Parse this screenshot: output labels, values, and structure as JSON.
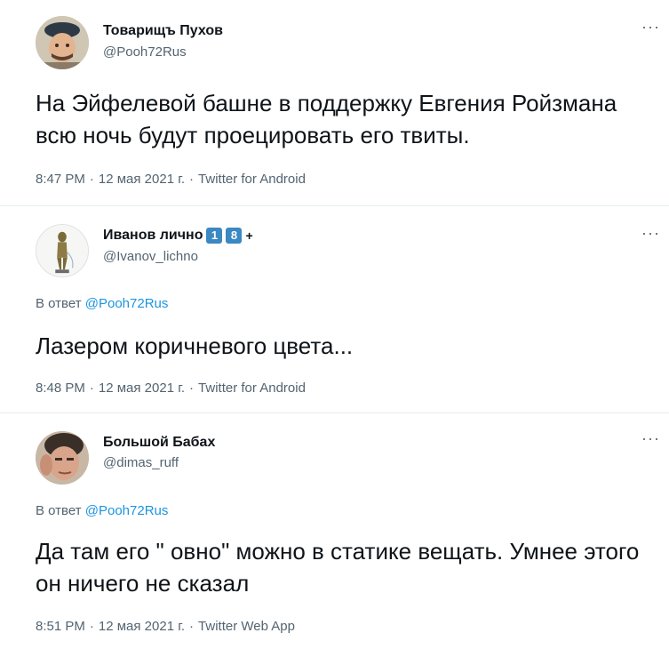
{
  "tweets": [
    {
      "display_name": "Товарищъ Пухов",
      "handle": "@Pooh72Rus",
      "text": "На Эйфелевой башне в поддержку Евгения Ройзмана всю ночь будут проецировать его твиты.",
      "time": "8:47 PM",
      "date": "12 мая 2021 г.",
      "source": "Twitter for Android",
      "more_label": "···"
    },
    {
      "display_name": "Иванов лично",
      "badges": [
        "1",
        "8"
      ],
      "badge_suffix": "+",
      "handle": "@Ivanov_lichno",
      "reply_prefix": "В ответ",
      "reply_to": "@Pooh72Rus",
      "text": "Лазером коричневого цвета...",
      "time": "8:48 PM",
      "date": "12 мая 2021 г.",
      "source": "Twitter for Android",
      "more_label": "···"
    },
    {
      "display_name": "Большой Бабах",
      "handle": "@dimas_ruff",
      "reply_prefix": "В ответ",
      "reply_to": "@Pooh72Rus",
      "text": "Да там его \" овно\" можно в статике вещать. Умнее этого он ничего не сказал",
      "time": "8:51 PM",
      "date": "12 мая 2021 г.",
      "source": "Twitter Web App",
      "more_label": "···"
    }
  ],
  "separator": "·",
  "colors": {
    "text_primary": "#0f1419",
    "text_secondary": "#536471",
    "link": "#1b95e0",
    "badge": "#3b88c3",
    "divider": "#e6ecf0"
  }
}
